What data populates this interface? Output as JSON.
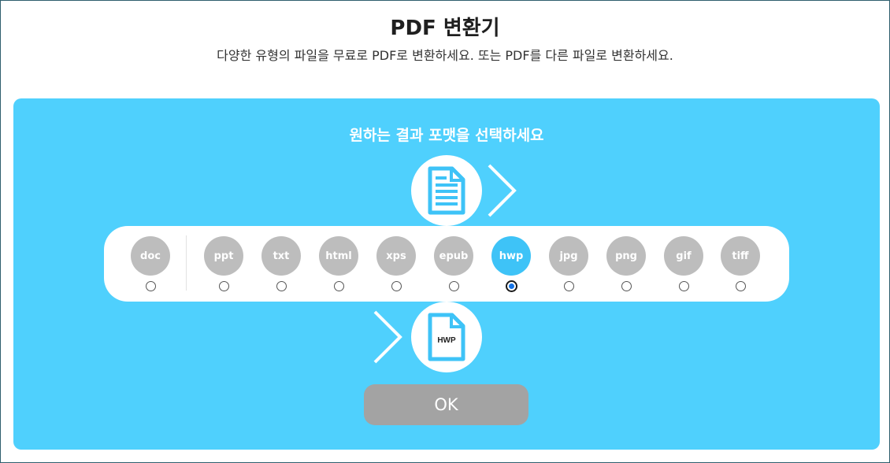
{
  "header": {
    "title": "PDF 변환기",
    "subtitle": "다양한 유형의 파일을 무료로 PDF로 변환하세요. 또는 PDF를 다른 파일로 변환하세요."
  },
  "panel": {
    "prompt": "원하는 결과 포맷을 선택하세요",
    "source_icon": "document-lines-icon",
    "target_icon": "file-icon",
    "target_label": "HWP",
    "colors": {
      "background": "#4fd0fd",
      "selected": "#3ec3f7",
      "unselected": "#bdbdbd",
      "ok_button": "#a3a3a3"
    }
  },
  "formats": [
    {
      "label": "doc",
      "selected": false
    },
    {
      "label": "ppt",
      "selected": false
    },
    {
      "label": "txt",
      "selected": false
    },
    {
      "label": "html",
      "selected": false
    },
    {
      "label": "xps",
      "selected": false
    },
    {
      "label": "epub",
      "selected": false
    },
    {
      "label": "hwp",
      "selected": true
    },
    {
      "label": "jpg",
      "selected": false
    },
    {
      "label": "png",
      "selected": false
    },
    {
      "label": "gif",
      "selected": false
    },
    {
      "label": "tiff",
      "selected": false
    }
  ],
  "ok_label": "OK"
}
